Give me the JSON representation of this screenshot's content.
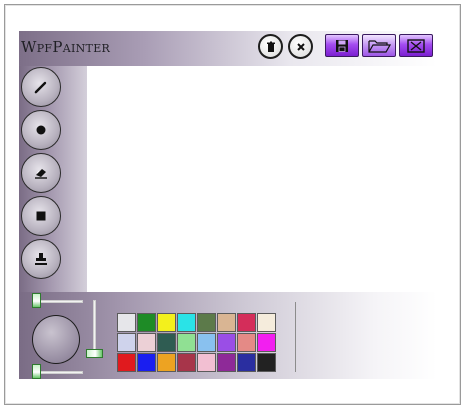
{
  "app": {
    "title": "WpfPainter"
  },
  "header_buttons": [
    {
      "name": "clear-button",
      "icon": "trash-icon"
    },
    {
      "name": "close-round-button",
      "icon": "close-icon"
    },
    {
      "name": "save-button",
      "icon": "floppy-disk-icon"
    },
    {
      "name": "open-button",
      "icon": "folder-open-icon"
    },
    {
      "name": "exit-button",
      "icon": "window-close-icon"
    }
  ],
  "tools": [
    {
      "name": "pen-tool",
      "icon": "pencil-icon"
    },
    {
      "name": "brush-tool",
      "icon": "dot-icon"
    },
    {
      "name": "eraser-tool",
      "icon": "eraser-icon"
    },
    {
      "name": "rectangle-tool",
      "icon": "square-icon"
    },
    {
      "name": "stamp-tool",
      "icon": "stamp-icon"
    }
  ],
  "brush": {
    "width_fraction": 0.1,
    "height_fraction": 0.15
  },
  "colors": {
    "accent_purple": "#8a2be2",
    "slider_thumb": "#69c86a",
    "palette": [
      "#e6e6ea",
      "#1e8b26",
      "#f3f01c",
      "#2ae3e7",
      "#5c7a4a",
      "#d9b593",
      "#d42d5a",
      "#f5ecdc",
      "#cfd3ec",
      "#ecd0d6",
      "#2f5c52",
      "#90e093",
      "#89c1ef",
      "#9a4ee6",
      "#e48a86",
      "#f21ff0",
      "#e01a1e",
      "#1a1ef0",
      "#eda322",
      "#a7354a",
      "#f2bfd2",
      "#8e2a98",
      "#2a2ea0",
      "#222222"
    ]
  }
}
